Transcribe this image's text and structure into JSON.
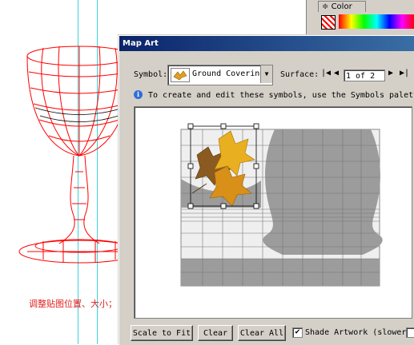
{
  "color_panel": {
    "tab_label": "Color",
    "tab_glyph": "≑"
  },
  "canvas": {
    "caption": "调整贴图位置、大小；",
    "colors": {
      "mesh": "#ff0000",
      "guide": "#3fd0d8",
      "caption": "#e02020"
    }
  },
  "dialog": {
    "title": "Map Art",
    "symbol_label": "Symbol:",
    "symbol_value": "Ground Covering",
    "surface_label": "Surface:",
    "surface_value": "1 of 2",
    "info_text": "To create and edit these symbols, use the Symbols palette.",
    "nav": {
      "first": "|◀",
      "prev": "◀",
      "next": "▶",
      "last": "▶|"
    },
    "buttons": {
      "scale_to_fit": "Scale to Fit",
      "clear": "Clear",
      "clear_all": "Clear All"
    },
    "shade_label": "Shade Artwork (slower)",
    "shade_checked": true,
    "colors": {
      "title_start": "#0a246a",
      "title_end": "#3a6ea5",
      "face": "#d4d0c8",
      "silhouette": "#9c9c9c"
    }
  }
}
